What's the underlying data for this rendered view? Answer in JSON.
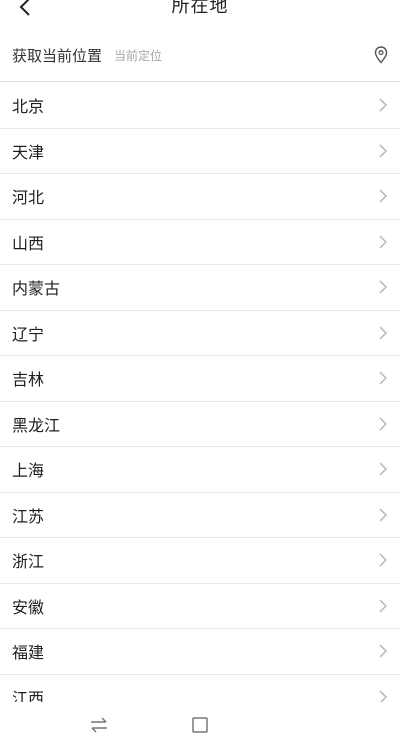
{
  "header": {
    "title": "所在地",
    "back_icon": "chevron-left-icon"
  },
  "location": {
    "label": "获取当前位置",
    "status": "当前定位",
    "icon": "location-pin-icon"
  },
  "provinces": [
    "北京",
    "天津",
    "河北",
    "山西",
    "内蒙古",
    "辽宁",
    "吉林",
    "黑龙江",
    "上海",
    "江苏",
    "浙江",
    "安徽",
    "福建",
    "江西"
  ],
  "nav": {
    "left_icon": "swap-arrows-icon",
    "center_icon": "square-icon"
  }
}
